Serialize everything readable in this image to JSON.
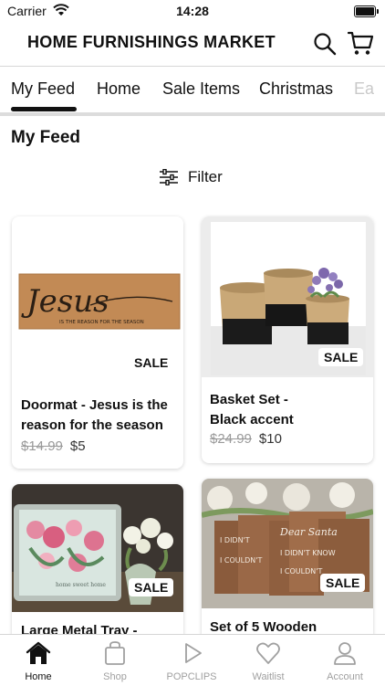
{
  "status_bar": {
    "carrier": "Carrier",
    "time": "14:28"
  },
  "header": {
    "title": "HOME FURNISHINGS MARKET"
  },
  "tabs": [
    {
      "label": "My Feed"
    },
    {
      "label": "Home"
    },
    {
      "label": "Sale Items"
    },
    {
      "label": "Christmas"
    },
    {
      "label": "Ea"
    }
  ],
  "section_title": "My Feed",
  "filter": {
    "label": "Filter"
  },
  "products": [
    {
      "name_line1": "Doormat - Jesus is the",
      "name_line2": "reason for the season",
      "badge": "SALE",
      "old_price": "$14.99",
      "price": "$5",
      "image_text": "Jesus",
      "image_subtext": "IS THE REASON FOR THE SEASON"
    },
    {
      "name_line1": "Basket Set -",
      "name_line2": "Black accent",
      "badge": "SALE",
      "old_price": "$24.99",
      "price": "$10"
    },
    {
      "name_line1": "Large Metal Tray -",
      "badge": "SALE"
    },
    {
      "name_line1": "Set of 5 Wooden",
      "badge": "SALE",
      "sign_texts": [
        "Dear Santa",
        "I DIDN'T KNOW",
        "I COULDN'T"
      ]
    }
  ],
  "bottom_nav": [
    {
      "label": "Home"
    },
    {
      "label": "Shop"
    },
    {
      "label": "POPCLIPS"
    },
    {
      "label": "Waitlist"
    },
    {
      "label": "Account"
    }
  ],
  "colors": {
    "accent": "#111111",
    "inactive": "#a0a0a0",
    "divider": "#dcdcdc"
  }
}
